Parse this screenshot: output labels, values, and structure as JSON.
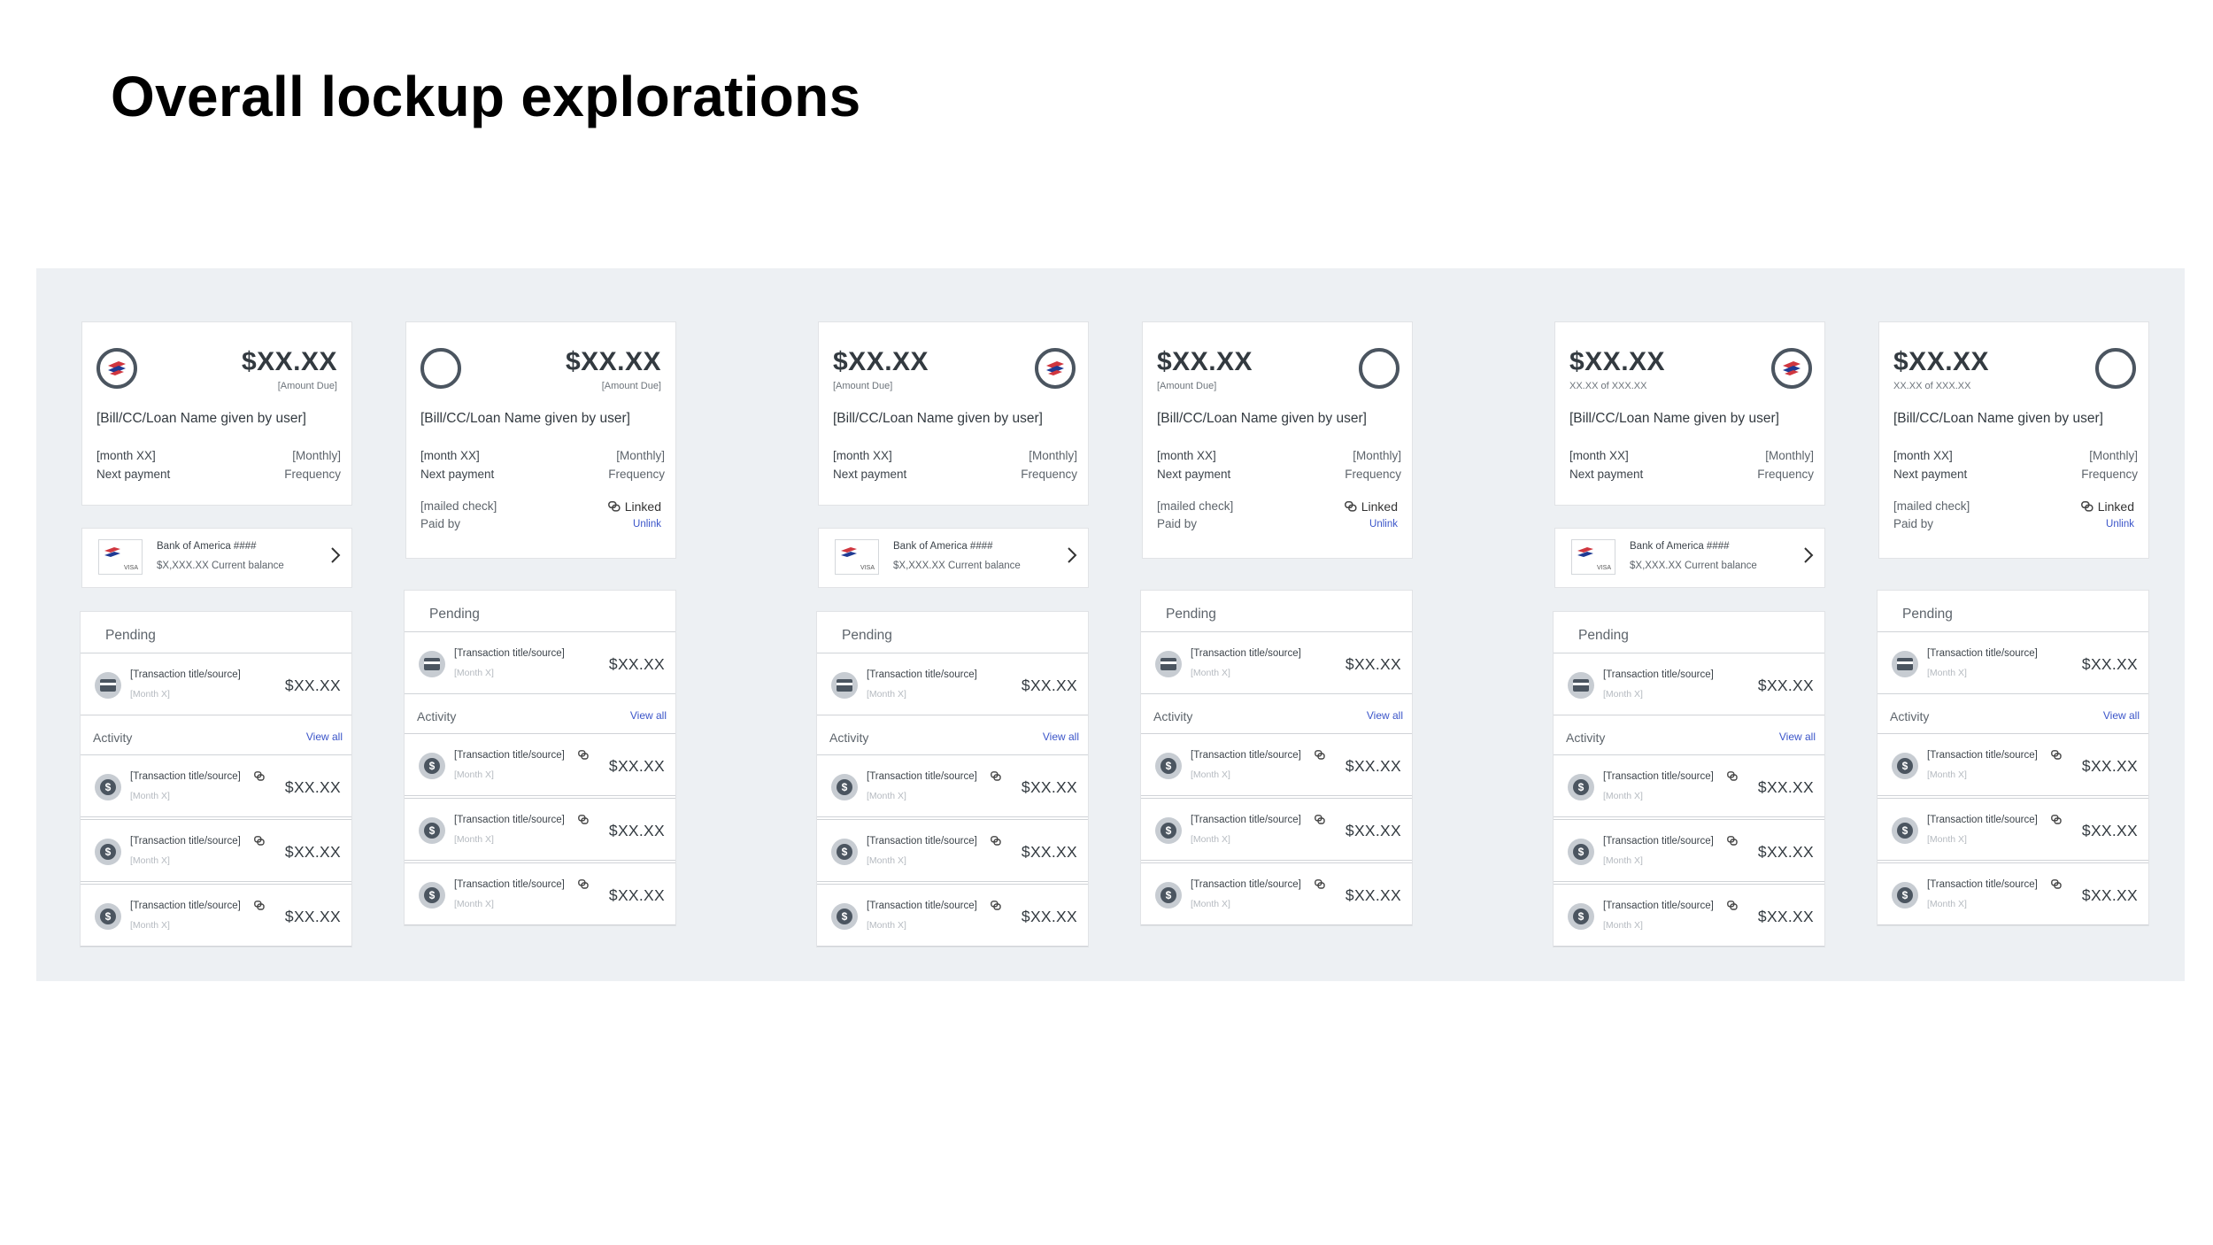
{
  "page": {
    "title": "Overall lockup explorations"
  },
  "common": {
    "amount": "$XX.XX",
    "amount_due": "[Amount Due]",
    "amount_progress": "XX.XX of XXX.XX",
    "bill_name": "[Bill/CC/Loan Name given by user]",
    "month": "[month XX]",
    "next_payment": "Next payment",
    "monthly": "[Monthly]",
    "frequency": "Frequency",
    "mailed_check": "[mailed check]",
    "paid_by": "Paid by",
    "linked": "Linked",
    "unlink": "Unlink",
    "account_name": "Bank of America ####",
    "account_balance": "$X,XXX.XX Current balance",
    "card_brand": "VISA",
    "pending": "Pending",
    "activity": "Activity",
    "view_all": "View all",
    "transaction_title": "[Transaction title/source]",
    "transaction_date": "[Month X]",
    "transaction_amount": "$XX.XX"
  },
  "icons": {
    "bank_logo": "bank-of-america-logo",
    "empty_logo": "empty-circle-icon",
    "link": "link-icon",
    "chevron": "chevron-right-icon",
    "card": "credit-card-icon",
    "dollar": "dollar-icon"
  },
  "colors": {
    "panel_bg": "#edf0f3",
    "accent_blue": "#3b55c9",
    "brand_red": "#d0363f",
    "brand_navy": "#1f3a93"
  }
}
